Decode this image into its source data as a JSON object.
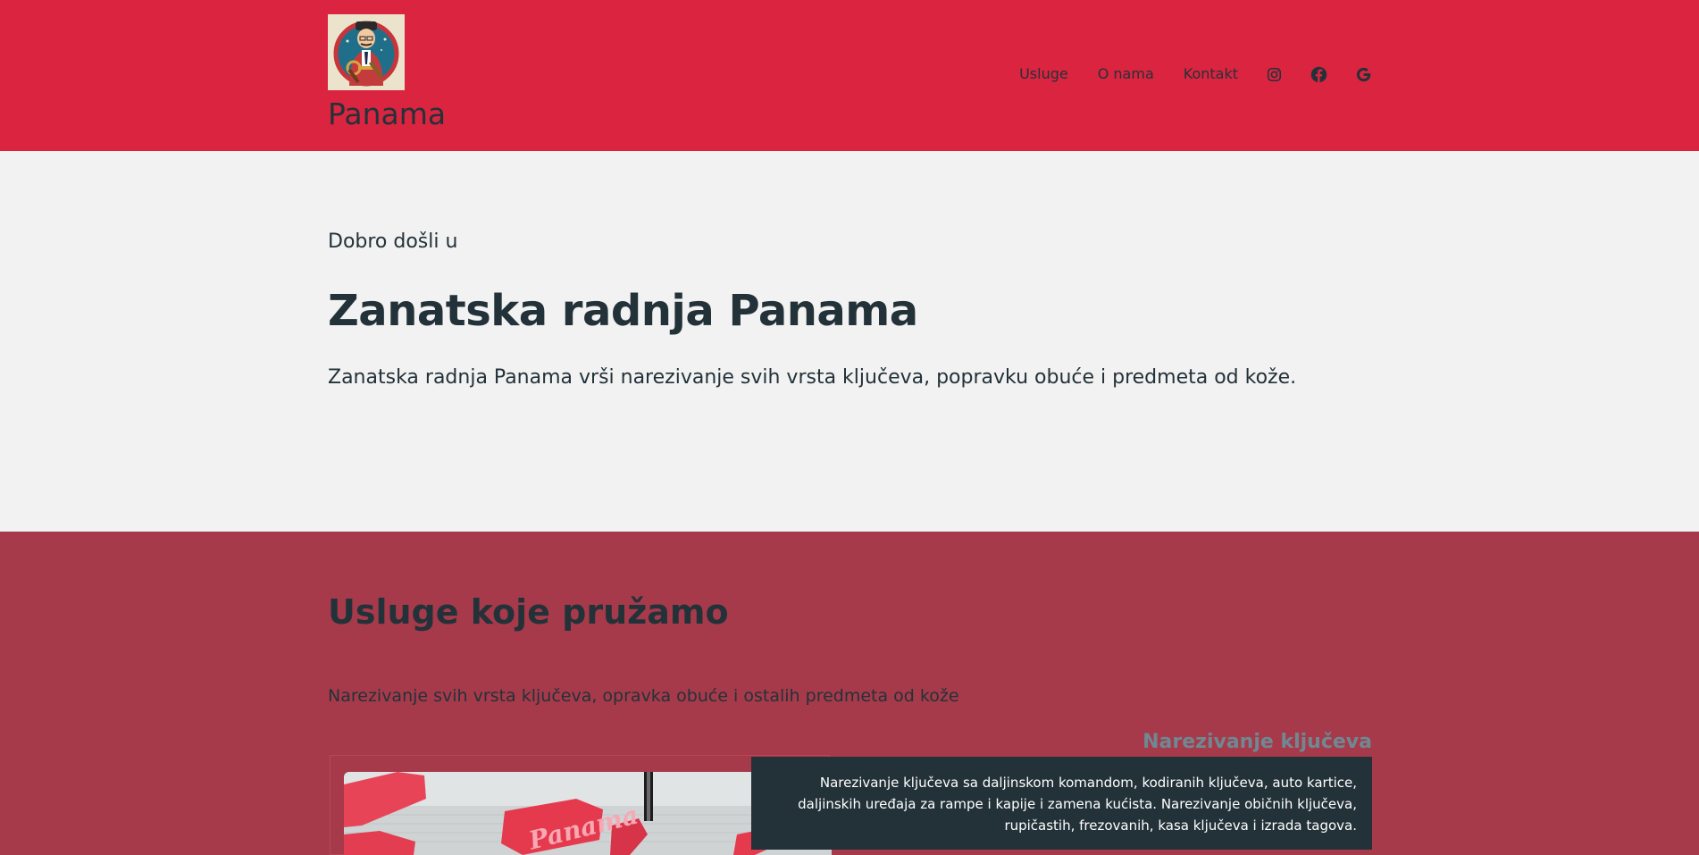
{
  "header": {
    "brand": "Panama",
    "nav": [
      {
        "label": "Usluge"
      },
      {
        "label": "O nama"
      },
      {
        "label": "Kontakt"
      }
    ],
    "social_icons": [
      "instagram-icon",
      "facebook-icon",
      "google-icon"
    ],
    "background": "#da2440"
  },
  "hero": {
    "welcome": "Dobro došli u",
    "title": "Zanatska radnja Panama",
    "description": "Zanatska radnja Panama vrši narezivanje svih vrsta ključeva, popravku obuće i predmeta od kože."
  },
  "services": {
    "title": "Usluge koje pružamo",
    "subtitle": "Narezivanje svih vrsta ključeva, opravka obuće i ostalih predmeta od kože",
    "card": {
      "title": "Narezivanje ključeva",
      "text": "Narezivanje ključeva sa daljinskom komandom, kodiranih ključeva, auto kartice, daljinskih uređaja za rampe i kapije i zamena kućista. Narezivanje običnih ključeva, rupičastih, frezovanih, kasa ključeva i izrada tagova.",
      "image_text": "Panama"
    },
    "background": "#a63a4a"
  }
}
